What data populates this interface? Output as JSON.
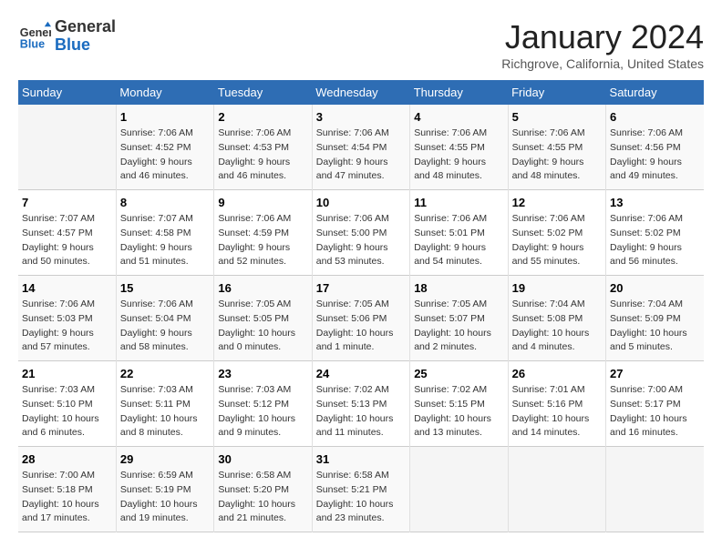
{
  "header": {
    "logo_general": "General",
    "logo_blue": "Blue",
    "month_title": "January 2024",
    "location": "Richgrove, California, United States"
  },
  "days_of_week": [
    "Sunday",
    "Monday",
    "Tuesday",
    "Wednesday",
    "Thursday",
    "Friday",
    "Saturday"
  ],
  "weeks": [
    [
      {
        "day": "",
        "info": ""
      },
      {
        "day": "1",
        "info": "Sunrise: 7:06 AM\nSunset: 4:52 PM\nDaylight: 9 hours\nand 46 minutes."
      },
      {
        "day": "2",
        "info": "Sunrise: 7:06 AM\nSunset: 4:53 PM\nDaylight: 9 hours\nand 46 minutes."
      },
      {
        "day": "3",
        "info": "Sunrise: 7:06 AM\nSunset: 4:54 PM\nDaylight: 9 hours\nand 47 minutes."
      },
      {
        "day": "4",
        "info": "Sunrise: 7:06 AM\nSunset: 4:55 PM\nDaylight: 9 hours\nand 48 minutes."
      },
      {
        "day": "5",
        "info": "Sunrise: 7:06 AM\nSunset: 4:55 PM\nDaylight: 9 hours\nand 48 minutes."
      },
      {
        "day": "6",
        "info": "Sunrise: 7:06 AM\nSunset: 4:56 PM\nDaylight: 9 hours\nand 49 minutes."
      }
    ],
    [
      {
        "day": "7",
        "info": "Sunrise: 7:07 AM\nSunset: 4:57 PM\nDaylight: 9 hours\nand 50 minutes."
      },
      {
        "day": "8",
        "info": "Sunrise: 7:07 AM\nSunset: 4:58 PM\nDaylight: 9 hours\nand 51 minutes."
      },
      {
        "day": "9",
        "info": "Sunrise: 7:06 AM\nSunset: 4:59 PM\nDaylight: 9 hours\nand 52 minutes."
      },
      {
        "day": "10",
        "info": "Sunrise: 7:06 AM\nSunset: 5:00 PM\nDaylight: 9 hours\nand 53 minutes."
      },
      {
        "day": "11",
        "info": "Sunrise: 7:06 AM\nSunset: 5:01 PM\nDaylight: 9 hours\nand 54 minutes."
      },
      {
        "day": "12",
        "info": "Sunrise: 7:06 AM\nSunset: 5:02 PM\nDaylight: 9 hours\nand 55 minutes."
      },
      {
        "day": "13",
        "info": "Sunrise: 7:06 AM\nSunset: 5:02 PM\nDaylight: 9 hours\nand 56 minutes."
      }
    ],
    [
      {
        "day": "14",
        "info": "Sunrise: 7:06 AM\nSunset: 5:03 PM\nDaylight: 9 hours\nand 57 minutes."
      },
      {
        "day": "15",
        "info": "Sunrise: 7:06 AM\nSunset: 5:04 PM\nDaylight: 9 hours\nand 58 minutes."
      },
      {
        "day": "16",
        "info": "Sunrise: 7:05 AM\nSunset: 5:05 PM\nDaylight: 10 hours\nand 0 minutes."
      },
      {
        "day": "17",
        "info": "Sunrise: 7:05 AM\nSunset: 5:06 PM\nDaylight: 10 hours\nand 1 minute."
      },
      {
        "day": "18",
        "info": "Sunrise: 7:05 AM\nSunset: 5:07 PM\nDaylight: 10 hours\nand 2 minutes."
      },
      {
        "day": "19",
        "info": "Sunrise: 7:04 AM\nSunset: 5:08 PM\nDaylight: 10 hours\nand 4 minutes."
      },
      {
        "day": "20",
        "info": "Sunrise: 7:04 AM\nSunset: 5:09 PM\nDaylight: 10 hours\nand 5 minutes."
      }
    ],
    [
      {
        "day": "21",
        "info": "Sunrise: 7:03 AM\nSunset: 5:10 PM\nDaylight: 10 hours\nand 6 minutes."
      },
      {
        "day": "22",
        "info": "Sunrise: 7:03 AM\nSunset: 5:11 PM\nDaylight: 10 hours\nand 8 minutes."
      },
      {
        "day": "23",
        "info": "Sunrise: 7:03 AM\nSunset: 5:12 PM\nDaylight: 10 hours\nand 9 minutes."
      },
      {
        "day": "24",
        "info": "Sunrise: 7:02 AM\nSunset: 5:13 PM\nDaylight: 10 hours\nand 11 minutes."
      },
      {
        "day": "25",
        "info": "Sunrise: 7:02 AM\nSunset: 5:15 PM\nDaylight: 10 hours\nand 13 minutes."
      },
      {
        "day": "26",
        "info": "Sunrise: 7:01 AM\nSunset: 5:16 PM\nDaylight: 10 hours\nand 14 minutes."
      },
      {
        "day": "27",
        "info": "Sunrise: 7:00 AM\nSunset: 5:17 PM\nDaylight: 10 hours\nand 16 minutes."
      }
    ],
    [
      {
        "day": "28",
        "info": "Sunrise: 7:00 AM\nSunset: 5:18 PM\nDaylight: 10 hours\nand 17 minutes."
      },
      {
        "day": "29",
        "info": "Sunrise: 6:59 AM\nSunset: 5:19 PM\nDaylight: 10 hours\nand 19 minutes."
      },
      {
        "day": "30",
        "info": "Sunrise: 6:58 AM\nSunset: 5:20 PM\nDaylight: 10 hours\nand 21 minutes."
      },
      {
        "day": "31",
        "info": "Sunrise: 6:58 AM\nSunset: 5:21 PM\nDaylight: 10 hours\nand 23 minutes."
      },
      {
        "day": "",
        "info": ""
      },
      {
        "day": "",
        "info": ""
      },
      {
        "day": "",
        "info": ""
      }
    ]
  ]
}
